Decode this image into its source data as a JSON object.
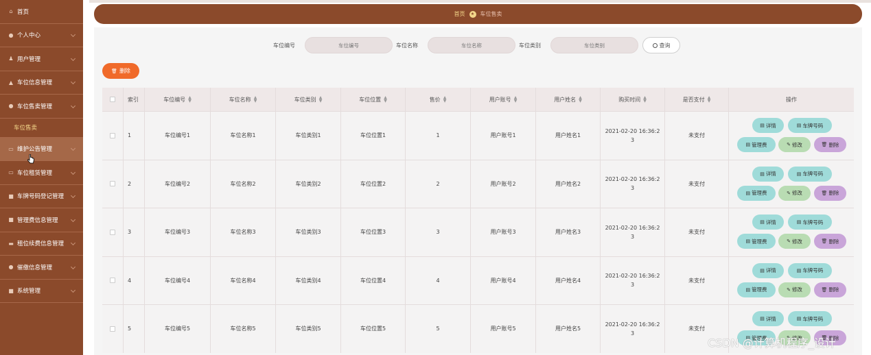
{
  "sidebar": {
    "items": [
      {
        "icon": "home-icon",
        "glyph": "⌂",
        "label": "首页",
        "chevron": false
      },
      {
        "icon": "user-icon",
        "glyph": "●",
        "label": "个人中心",
        "chevron": true
      },
      {
        "icon": "users-icon",
        "glyph": "♟",
        "label": "用户管理",
        "chevron": true
      },
      {
        "icon": "chart-icon",
        "glyph": "▲",
        "label": "车位信息管理",
        "chevron": true
      },
      {
        "icon": "location-icon",
        "glyph": "●",
        "label": "车位售卖管理",
        "chevron": true
      }
    ],
    "submenu": {
      "label": "车位售卖"
    },
    "items2": [
      {
        "icon": "notice-icon",
        "glyph": "▭",
        "label": "维护公告管理",
        "chevron": true
      },
      {
        "icon": "message-icon",
        "glyph": "▭",
        "label": "车位租赁管理",
        "chevron": true
      },
      {
        "icon": "car-icon",
        "glyph": "■",
        "label": "车牌号码登记管理",
        "chevron": true
      },
      {
        "icon": "fee-icon",
        "glyph": "■",
        "label": "管理费信息管理",
        "chevron": true
      },
      {
        "icon": "card-icon",
        "glyph": "▬",
        "label": "租位续费信息管理",
        "chevron": true
      },
      {
        "icon": "bell-icon",
        "glyph": "●",
        "label": "催缴信息管理",
        "chevron": true
      },
      {
        "icon": "settings-icon",
        "glyph": "■",
        "label": "系统管理",
        "chevron": true
      }
    ]
  },
  "breadcrumb": {
    "home": "首页",
    "current": "车位售卖"
  },
  "search": {
    "field1_label": "车位编号",
    "field1_placeholder": "车位编号",
    "field2_label": "车位名称",
    "field2_placeholder": "车位名称",
    "field3_label": "车位类别",
    "field3_placeholder": "车位类别",
    "button_label": "查询"
  },
  "toolbar": {
    "delete_label": "删除"
  },
  "table": {
    "headers": [
      "索引",
      "车位编号",
      "车位名称",
      "车位类别",
      "车位位置",
      "售价",
      "用户账号",
      "用户姓名",
      "购买时间",
      "是否支付",
      "操作"
    ],
    "actions": {
      "detail": "详情",
      "plate": "车牌号码",
      "fee": "管理费",
      "edit": "修改",
      "delete": "删除"
    },
    "rows": [
      {
        "index": "1",
        "code": "车位编号1",
        "name": "车位名称1",
        "category": "车位类别1",
        "location": "车位位置1",
        "price": "1",
        "account": "用户账号1",
        "username": "用户姓名1",
        "time": "2021-02-20 16:36:23",
        "paid": "未支付"
      },
      {
        "index": "2",
        "code": "车位编号2",
        "name": "车位名称2",
        "category": "车位类别2",
        "location": "车位位置2",
        "price": "2",
        "account": "用户账号2",
        "username": "用户姓名2",
        "time": "2021-02-20 16:36:23",
        "paid": "未支付"
      },
      {
        "index": "3",
        "code": "车位编号3",
        "name": "车位名称3",
        "category": "车位类别3",
        "location": "车位位置3",
        "price": "3",
        "account": "用户账号3",
        "username": "用户姓名3",
        "time": "2021-02-20 16:36:23",
        "paid": "未支付"
      },
      {
        "index": "4",
        "code": "车位编号4",
        "name": "车位名称4",
        "category": "车位类别4",
        "location": "车位位置4",
        "price": "4",
        "account": "用户账号4",
        "username": "用户姓名4",
        "time": "2021-02-20 16:36:23",
        "paid": "未支付"
      },
      {
        "index": "5",
        "code": "车位编号5",
        "name": "车位名称5",
        "category": "车位类别5",
        "location": "车位位置5",
        "price": "5",
        "account": "用户账号5",
        "username": "用户姓名5",
        "time": "2021-02-20 16:36:23",
        "paid": "未支付"
      }
    ]
  },
  "watermark": "CSDN @计算机程序_设计",
  "colors": {
    "sidebar": "#8b4a2b",
    "accent": "#f06a2a",
    "highlight": "#f3d68a"
  }
}
